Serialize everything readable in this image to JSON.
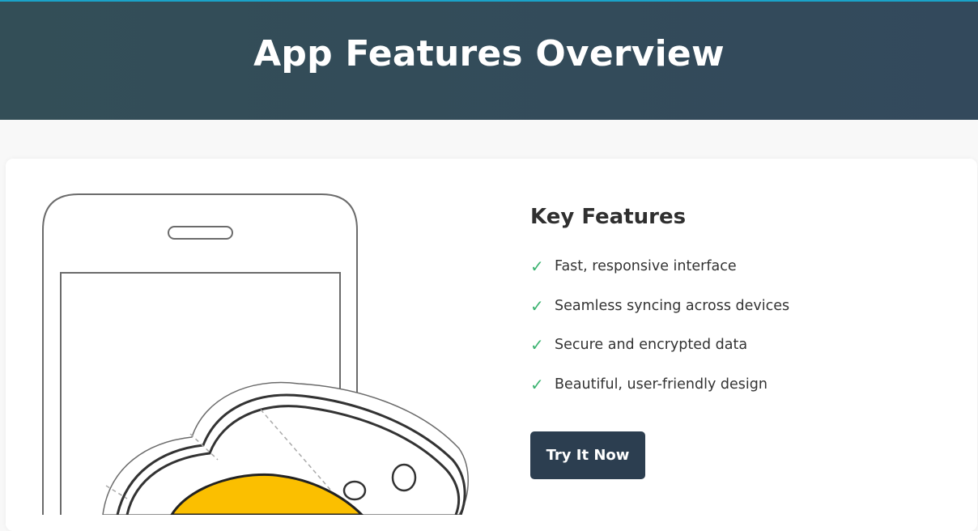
{
  "header": {
    "title": "App Features Overview"
  },
  "features": {
    "heading": "Key Features",
    "check_icon": "✓",
    "items": [
      "Fast, responsive interface",
      "Seamless syncing across devices",
      "Secure and encrypted data",
      "Beautiful, user-friendly design"
    ],
    "cta_label": "Try It Now"
  },
  "colors": {
    "header_bg": "#334e57",
    "accent_line": "#1aa3c9",
    "check": "#3cb371",
    "button_bg": "#2c3e50",
    "illustration_yellow": "#fbbf00"
  }
}
